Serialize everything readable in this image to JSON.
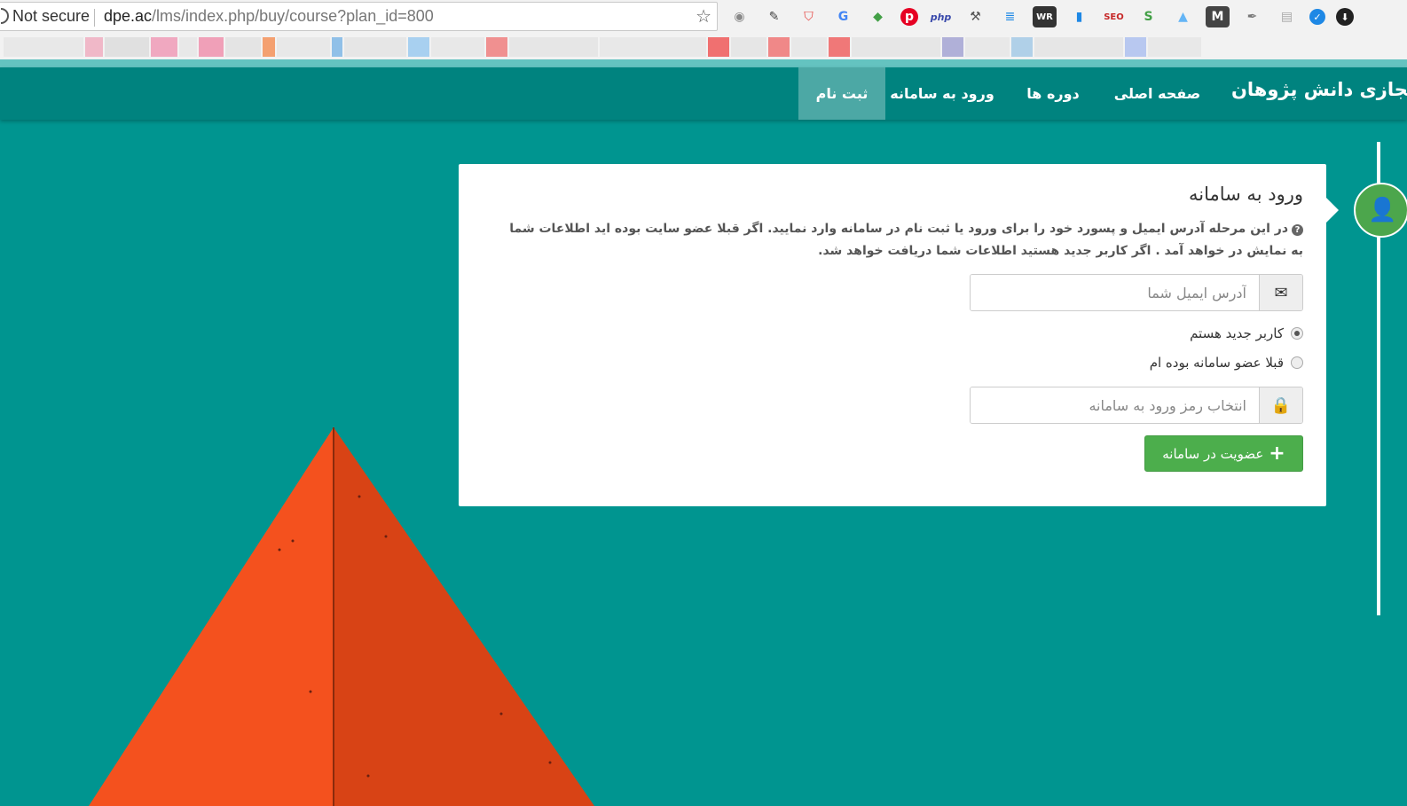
{
  "browser": {
    "security_label": "Not secure",
    "url_host": "dpe.ac",
    "url_path": "/lms/index.php/buy/course?plan_id=800",
    "extensions": [
      "camera-icon",
      "eyedropper-icon",
      "shield-icon",
      "translate-icon",
      "diamond-icon",
      "pinterest-icon",
      "php-icon",
      "hammer-icon",
      "stack-icon",
      "wr-icon",
      "chart-icon",
      "seo-icon",
      "seo-quake-icon",
      "extension-icon",
      "m-icon",
      "feather-icon",
      "notes-icon",
      "check-icon",
      "download-icon"
    ]
  },
  "nav": {
    "brand": "آموزش مجازی دانش پژوهان",
    "items": [
      {
        "label": "صفحه اصلی"
      },
      {
        "label": "دوره ها"
      },
      {
        "label": "ورود به سامانه"
      },
      {
        "label": "ثبت نام"
      }
    ],
    "active_index": 3
  },
  "login": {
    "title": "ورود به سامانه",
    "help_text": "در این مرحله آدرس ایمیل و پسورد خود را برای ورود یا ثبت نام در سامانه وارد نمایید. اگر قبلا عضو سایت بوده اید اطلاعات شما به نمایش در خواهد آمد . اگر کاربر جدید هستید اطلاعات شما دریافت خواهد شد.",
    "email_placeholder": "آدرس ایمیل شما",
    "email_value": "",
    "radio_new_user": "کاربر جدید هستم",
    "radio_existing_user": "قبلا عضو سامانه بوده ام",
    "selected_radio": "new_user",
    "password_placeholder": "انتخاب رمز ورود به سامانه",
    "submit_label": "عضویت در سامانه"
  },
  "colors": {
    "page_bg": "#009590",
    "navbar": "#00837f",
    "nav_active": "#4ca8a5",
    "success": "#4cae4c",
    "pyramid_left": "#f4511e",
    "pyramid_right": "#d84315"
  }
}
